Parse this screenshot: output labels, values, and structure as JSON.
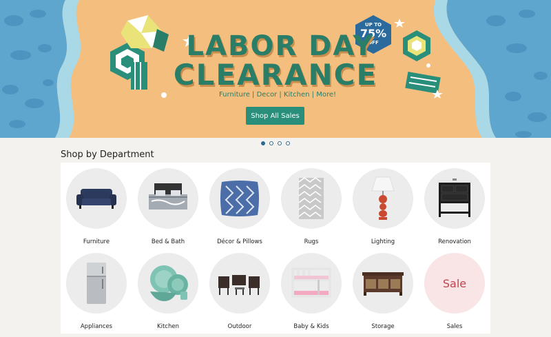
{
  "hero": {
    "title_line1": "LABOR DAY",
    "title_line2": "CLEARANCE",
    "subtitle": "Furniture | Decor | Kitchen | More!",
    "button_label": "Shop All Sales",
    "badge_top": "UP TO",
    "badge_value": "75%",
    "badge_bottom": "OFF"
  },
  "carousel": {
    "dot_count": 4,
    "active_index": 0
  },
  "section": {
    "title": "Shop by Department"
  },
  "departments": [
    {
      "label": "Furniture",
      "icon": "sofa-icon"
    },
    {
      "label": "Bed & Bath",
      "icon": "bed-icon"
    },
    {
      "label": "Décor & Pillows",
      "icon": "pillow-icon"
    },
    {
      "label": "Rugs",
      "icon": "rug-icon"
    },
    {
      "label": "Lighting",
      "icon": "lamp-icon"
    },
    {
      "label": "Renovation",
      "icon": "vanity-icon"
    },
    {
      "label": "Appliances",
      "icon": "refrigerator-icon"
    },
    {
      "label": "Kitchen",
      "icon": "dishes-icon"
    },
    {
      "label": "Outdoor",
      "icon": "patio-set-icon"
    },
    {
      "label": "Baby & Kids",
      "icon": "bunk-bed-icon"
    },
    {
      "label": "Storage",
      "icon": "storage-bench-icon"
    },
    {
      "label": "Sales",
      "icon": "sale-text",
      "circle_text": "Sale"
    }
  ],
  "colors": {
    "brand_teal": "#2a8f7a",
    "hero_text": "#2a7d66",
    "sand": "#f3be7e",
    "water": "#5fa6cf",
    "sale_bg": "#f9e4e6",
    "sale_text": "#c0434f"
  }
}
